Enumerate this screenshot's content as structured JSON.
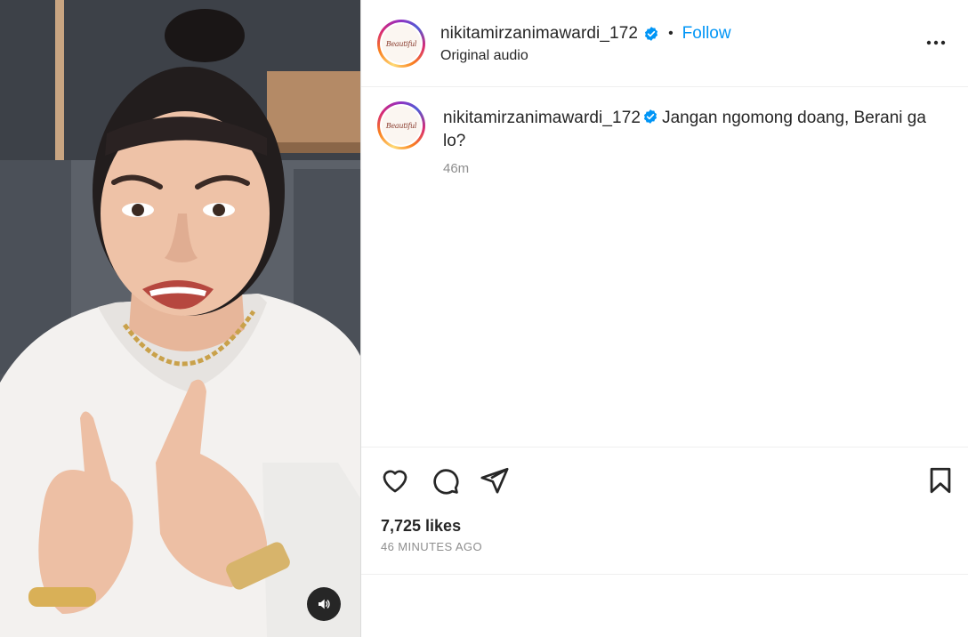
{
  "post": {
    "username": "nikitamirzanimawardi_172",
    "verified": true,
    "separator": "•",
    "follow_label": "Follow",
    "audio_label": "Original audio",
    "avatar_logo_text": "Beautiful",
    "caption_username": "nikitamirzanimawardi_172",
    "caption_text": "Jangan ngomong doang, Berani ga lo?",
    "caption_time": "46m",
    "likes": "7,725 likes",
    "time_ago": "46 MINUTES AGO"
  },
  "icons": {
    "more": "more-horizontal-icon",
    "verified": "verified-badge-icon",
    "like": "heart-icon",
    "comment": "comment-icon",
    "share": "send-icon",
    "save": "bookmark-icon",
    "audio": "speaker-icon"
  },
  "colors": {
    "accent": "#0095f6",
    "verified": "#0095f6",
    "text": "#262626",
    "muted": "#8e8e8e"
  }
}
